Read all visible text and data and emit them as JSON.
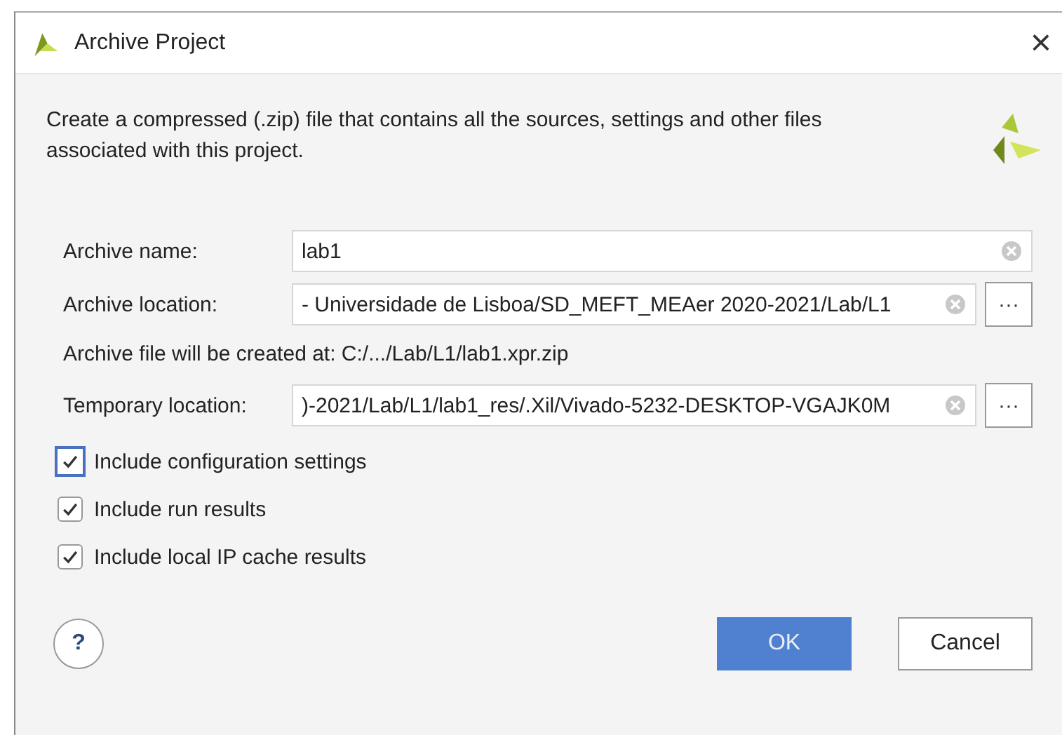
{
  "window": {
    "title": "Archive Project",
    "close": "×"
  },
  "description": "Create a compressed (.zip) file that contains all the sources, settings and other files associated with this project.",
  "fields": [
    {
      "kind": "text",
      "label": "Archive name:",
      "value": "lab1"
    },
    {
      "kind": "path",
      "label": "Archive location:",
      "value": "- Universidade de Lisboa/SD_MEFT_MEAer 2020-2021/Lab/L1",
      "browse": "···"
    },
    {
      "kind": "info",
      "label": "Archive file will be created at: C:/.../Lab/L1/lab1.xpr.zip"
    },
    {
      "kind": "path",
      "label": "Temporary location:",
      "value": ")-2021/Lab/L1/lab1_res/.Xil/Vivado-5232-DESKTOP-VGAJK0M",
      "browse": "···"
    }
  ],
  "options": [
    {
      "label": "Include configuration settings",
      "checked": true,
      "focused": true
    },
    {
      "label": "Include run results",
      "checked": true,
      "focused": false
    },
    {
      "label": "Include local IP cache results",
      "checked": true,
      "focused": false
    }
  ],
  "help": "?",
  "buttons": [
    {
      "label": "OK",
      "kind": "primary"
    },
    {
      "label": "Cancel",
      "kind": "secondary"
    }
  ]
}
